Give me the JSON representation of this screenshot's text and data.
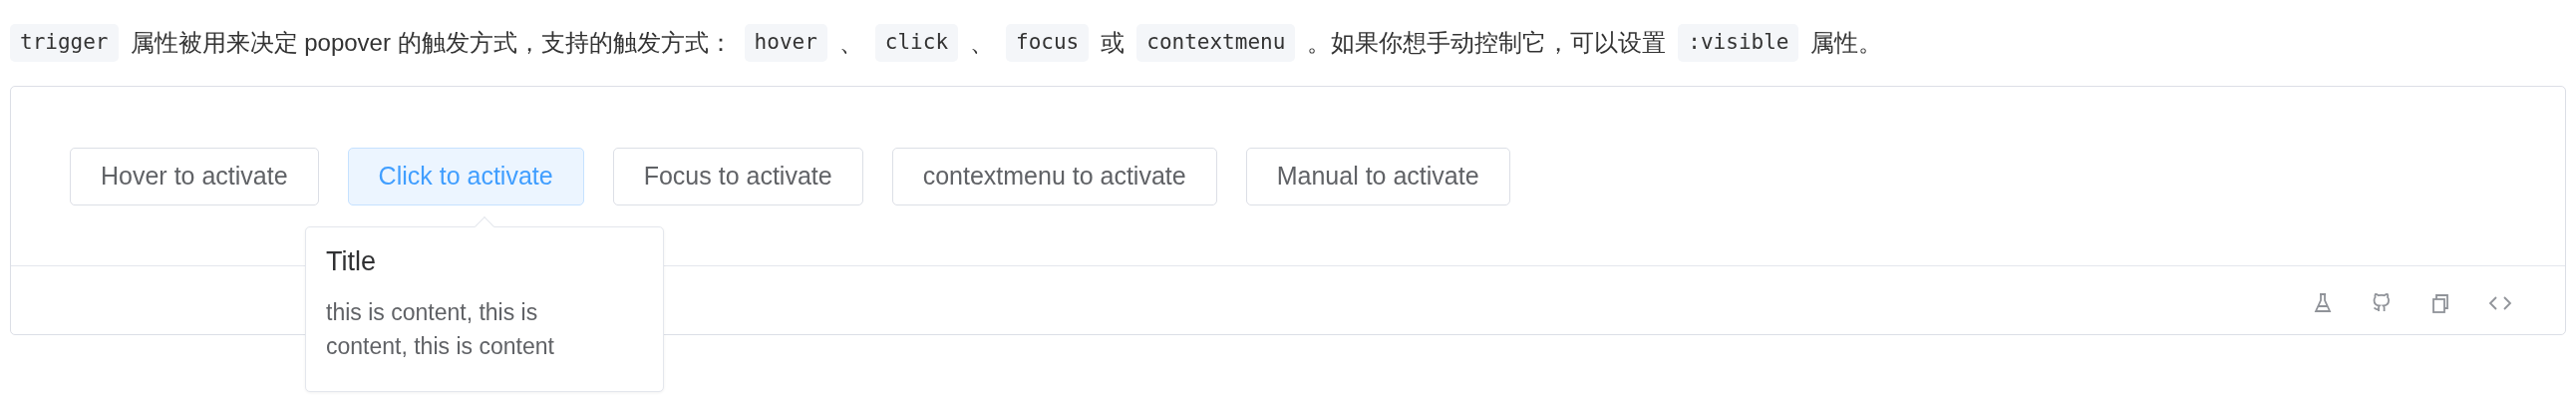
{
  "description": [
    {
      "kind": "code",
      "text": "trigger"
    },
    {
      "kind": "text",
      "text": "属性被用来决定 popover 的触发方式，支持的触发方式："
    },
    {
      "kind": "code",
      "text": "hover"
    },
    {
      "kind": "text",
      "text": "、"
    },
    {
      "kind": "code",
      "text": "click"
    },
    {
      "kind": "text",
      "text": "、"
    },
    {
      "kind": "code",
      "text": "focus"
    },
    {
      "kind": "text",
      "text": "或"
    },
    {
      "kind": "code",
      "text": "contextmenu"
    },
    {
      "kind": "text",
      "text": "。如果你想手动控制它，可以设置"
    },
    {
      "kind": "code",
      "text": ":visible"
    },
    {
      "kind": "text",
      "text": "属性。"
    }
  ],
  "buttons": [
    {
      "label": "Hover to activate",
      "selected": false
    },
    {
      "label": "Click to activate",
      "selected": true
    },
    {
      "label": "Focus to activate",
      "selected": false
    },
    {
      "label": "contextmenu to activate",
      "selected": false
    },
    {
      "label": "Manual to activate",
      "selected": false
    }
  ],
  "popover": {
    "title": "Title",
    "content": "this is content, this is content, this is content"
  }
}
